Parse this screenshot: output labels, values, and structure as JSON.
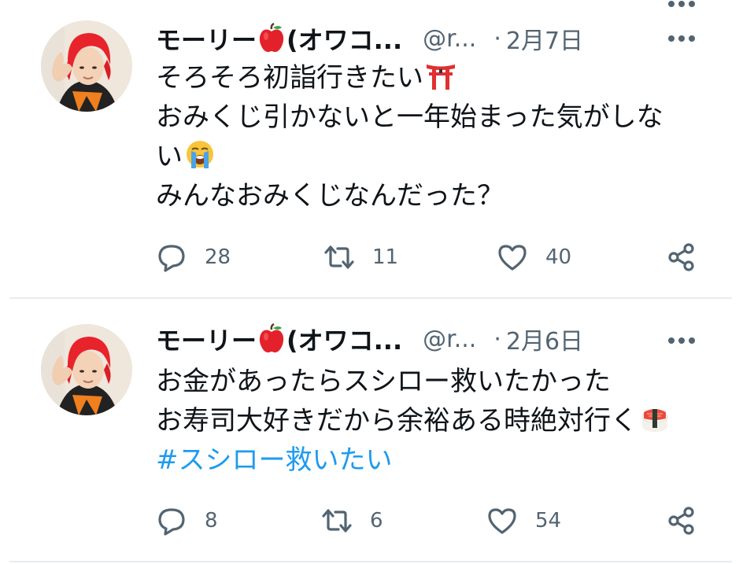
{
  "colors": {
    "text": "#0f1419",
    "secondary": "#536471",
    "hashtag": "#1d9bf0",
    "divider": "#e8ecef"
  },
  "tweets": [
    {
      "display_name": "モーリー",
      "display_name_tail": "(オワコ...",
      "name_emoji": "red-apple-icon",
      "handle": "@r...",
      "separator": "·",
      "date": "2月7日",
      "lines": [
        {
          "text": "そろそろ初詣行きたい",
          "emoji": "shinto-shrine-icon"
        },
        {
          "text": "おみくじ引かないと一年始まった気がしな",
          "emoji": ""
        },
        {
          "text": "い",
          "emoji": "loudly-crying-face-icon"
        },
        {
          "text": "みんなおみくじなんだった？",
          "emoji": ""
        }
      ],
      "hashtag": "",
      "replies": "28",
      "retweets": "11",
      "likes": "40"
    },
    {
      "display_name": "モーリー",
      "display_name_tail": "(オワコ...",
      "name_emoji": "red-apple-icon",
      "handle": "@r...",
      "separator": "·",
      "date": "2月6日",
      "lines": [
        {
          "text": "お金があったらスシロー救いたかった",
          "emoji": ""
        },
        {
          "text": "お寿司大好きだから余裕ある時絶対行く",
          "emoji": "sushi-icon"
        }
      ],
      "hashtag": "#スシロー救いたい",
      "replies": "8",
      "retweets": "6",
      "likes": "54"
    }
  ]
}
